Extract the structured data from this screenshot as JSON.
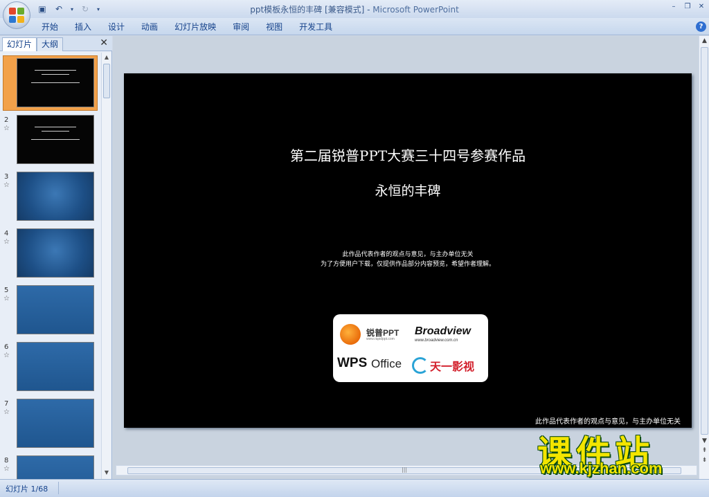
{
  "window": {
    "title": "ppt模板永恒的丰碑 [兼容模式]",
    "separator": " - ",
    "app_name": "Microsoft PowerPoint"
  },
  "ribbon": {
    "tabs": [
      "开始",
      "插入",
      "设计",
      "动画",
      "幻灯片放映",
      "审阅",
      "视图",
      "开发工具"
    ]
  },
  "left_pane": {
    "tabs": [
      "幻灯片",
      "大纲"
    ],
    "close_icon": "close-icon",
    "thumbnails": [
      {
        "num": "",
        "style": "dark",
        "selected": true
      },
      {
        "num": "2",
        "style": "dark"
      },
      {
        "num": "3",
        "style": "blue"
      },
      {
        "num": "4",
        "style": "blue"
      },
      {
        "num": "5",
        "style": "blue2"
      },
      {
        "num": "6",
        "style": "blue2"
      },
      {
        "num": "7",
        "style": "blue2"
      },
      {
        "num": "8",
        "style": "blue2"
      }
    ]
  },
  "slide": {
    "title": "第二届锐普PPT大赛三十四号参赛作品",
    "subtitle": "永恒的丰碑",
    "note_line1": "此作品代表作者的观点与意见，与主办单位无关",
    "note_line2": "为了方便用户下载，仅提供作品部分内容预览，希望作者理解。",
    "logos": {
      "ruipu": "锐普PPT",
      "ruipu_url": "www.rapidppt.com",
      "broadview": "Broadview",
      "broadview_url": "www.broadview.com.cn",
      "wps": "WPS",
      "office": "Office",
      "tianyi": "天一影视"
    },
    "footer": "此作品代表作者的观点与意见，与主办单位无关"
  },
  "status": {
    "slide_indicator": "幻灯片 1/68"
  },
  "watermark": {
    "cn": "课件站",
    "url": "www.kjzhan.com"
  },
  "colors": {
    "ribbon_text": "#15428b",
    "selection": "#f2a14a",
    "watermark_yellow": "#f3e500"
  }
}
